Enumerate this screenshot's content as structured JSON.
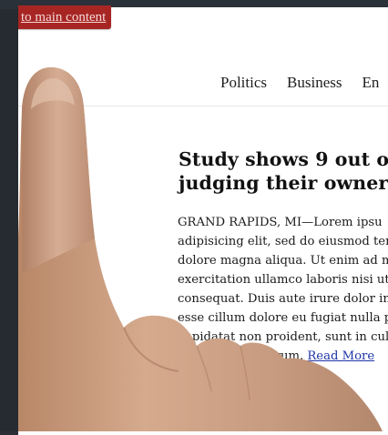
{
  "skip_link": "to main content",
  "nav": {
    "items": [
      "Politics",
      "Business",
      "En"
    ]
  },
  "article": {
    "headline_lines": [
      "Study shows 9 out o",
      "judging their owner"
    ],
    "body_lines": [
      "GRAND RAPIDS, MI—Lorem ipsu",
      "adipisicing elit, sed do eiusmod ter",
      "dolore magna aliqua. Ut enim ad m",
      "exercitation ullamco laboris nisi ut",
      "consequat. Duis aute irure dolor in",
      "esse cillum dolore eu fugiat nulla p",
      "cupidatat non proident, sunt in cul"
    ],
    "last_line_prefix": "anim id est laborum. ",
    "read_more": "Read More"
  },
  "colors": {
    "skip_link_bg": "#a72624",
    "link": "#1f35a8",
    "chrome": "#262b31"
  },
  "icons": {
    "overlay": "pointing-hand"
  }
}
